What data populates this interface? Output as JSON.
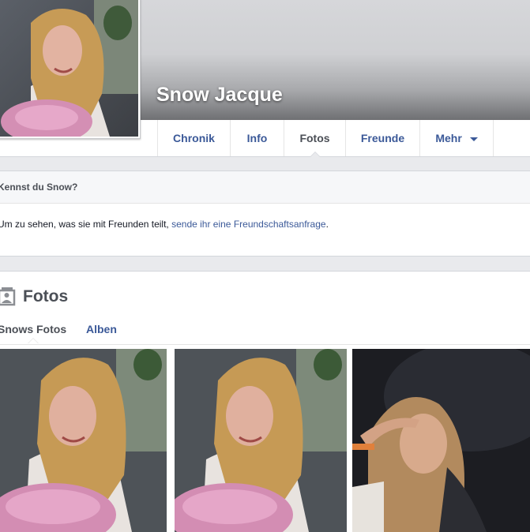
{
  "profile": {
    "name": "Snow Jacque",
    "picture_alt": "profile-picture"
  },
  "nav": {
    "tabs": [
      {
        "label": "Chronik"
      },
      {
        "label": "Info"
      },
      {
        "label": "Fotos"
      },
      {
        "label": "Freunde"
      },
      {
        "label": "Mehr"
      }
    ],
    "active": "Fotos"
  },
  "know_box": {
    "title": "Kennst du Snow?",
    "text_before": "Um zu sehen, was sie mit Freunden teilt, ",
    "link": "sende ihr eine Freundschaftsanfrage",
    "text_after": "."
  },
  "photos": {
    "title": "Fotos",
    "tabs": [
      {
        "label": "Snows Fotos"
      },
      {
        "label": "Alben"
      }
    ],
    "active_tab": "Snows Fotos",
    "items": [
      {
        "name": "photo-1"
      },
      {
        "name": "photo-2"
      },
      {
        "name": "photo-3"
      }
    ]
  },
  "colors": {
    "link": "#3b5998",
    "page_bg": "#e9eaed",
    "header_gradient_end": "#6f7073"
  }
}
